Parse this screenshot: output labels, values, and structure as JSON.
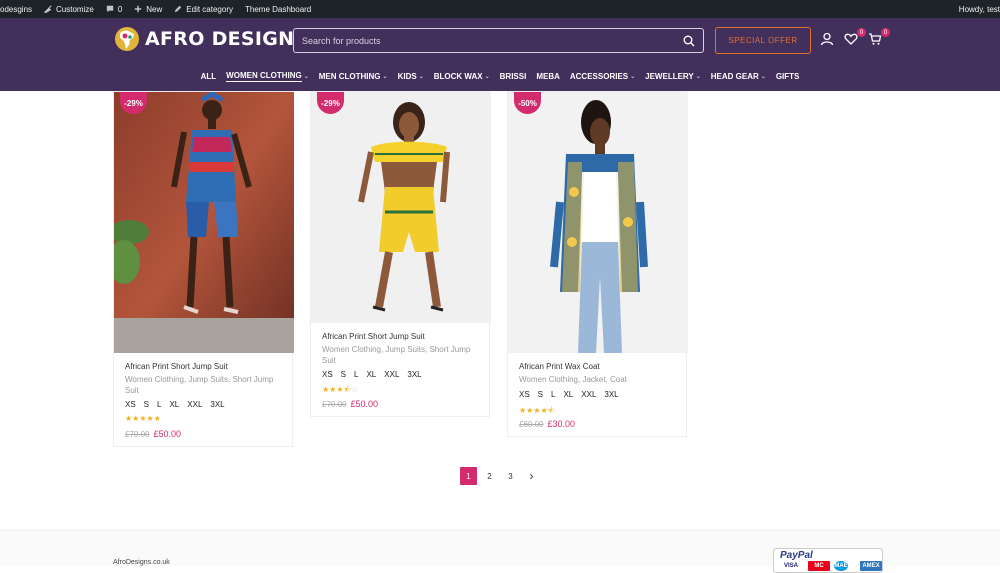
{
  "admin_bar": {
    "site": "odesgins",
    "customize": "Customize",
    "comments": "0",
    "new": "New",
    "edit_category": "Edit category",
    "theme_dashboard": "Theme Dashboard",
    "howdy": "Howdy, test"
  },
  "header": {
    "logo_text": "AFRO DESIGNS",
    "search_placeholder": "Search for products",
    "special_offer": "SPECIAL OFFER",
    "wishlist_count": "0",
    "cart_count": "0"
  },
  "nav": [
    {
      "label": "ALL",
      "dropdown": false
    },
    {
      "label": "WOMEN CLOTHING",
      "dropdown": true,
      "active": true
    },
    {
      "label": "MEN CLOTHING",
      "dropdown": true
    },
    {
      "label": "KIDS",
      "dropdown": true
    },
    {
      "label": "BLOCK WAX",
      "dropdown": true
    },
    {
      "label": "BRISSI",
      "dropdown": false
    },
    {
      "label": "MEBA",
      "dropdown": false
    },
    {
      "label": "ACCESSORIES",
      "dropdown": true
    },
    {
      "label": "JEWELLERY",
      "dropdown": true
    },
    {
      "label": "HEAD GEAR",
      "dropdown": true
    },
    {
      "label": "GIFTS",
      "dropdown": false
    }
  ],
  "products": [
    {
      "badge": "-29%",
      "name": "African Print Short Jump Suit",
      "categories": "Women Clothing, Jump Suits, Short Jump Suit",
      "sizes": [
        "XS",
        "S",
        "L",
        "XL",
        "XXL",
        "3XL"
      ],
      "rating": 5,
      "old_price": "£70.00",
      "new_price": "£50.00"
    },
    {
      "badge": "-29%",
      "name": "African Print Short Jump Suit",
      "categories": "Women Clothing, Jump Suits, Short Jump Suit",
      "sizes": [
        "XS",
        "S",
        "L",
        "XL",
        "XXL",
        "3XL"
      ],
      "rating": 3.5,
      "old_price": "£70.00",
      "new_price": "£50.00"
    },
    {
      "badge": "-50%",
      "name": "African Print Wax Coat",
      "categories": "Women Clothing, Jacket, Coat",
      "sizes": [
        "XS",
        "S",
        "L",
        "XL",
        "XXL",
        "3XL"
      ],
      "rating": 4.5,
      "old_price": "£60.00",
      "new_price": "£30.00"
    }
  ],
  "pagination": {
    "pages": [
      "1",
      "2",
      "3"
    ],
    "current": "1",
    "next": "›"
  },
  "footer": {
    "site": "AfroDesigns.co.uk",
    "paypal": "PayPal",
    "cards": [
      "VISA",
      "MC",
      "MAE",
      "AMEX"
    ]
  },
  "colors": {
    "header_bg": "#432f5c",
    "accent_pink": "#d42b6e",
    "special_offer": "#e2712f",
    "star": "#f2b01e"
  }
}
